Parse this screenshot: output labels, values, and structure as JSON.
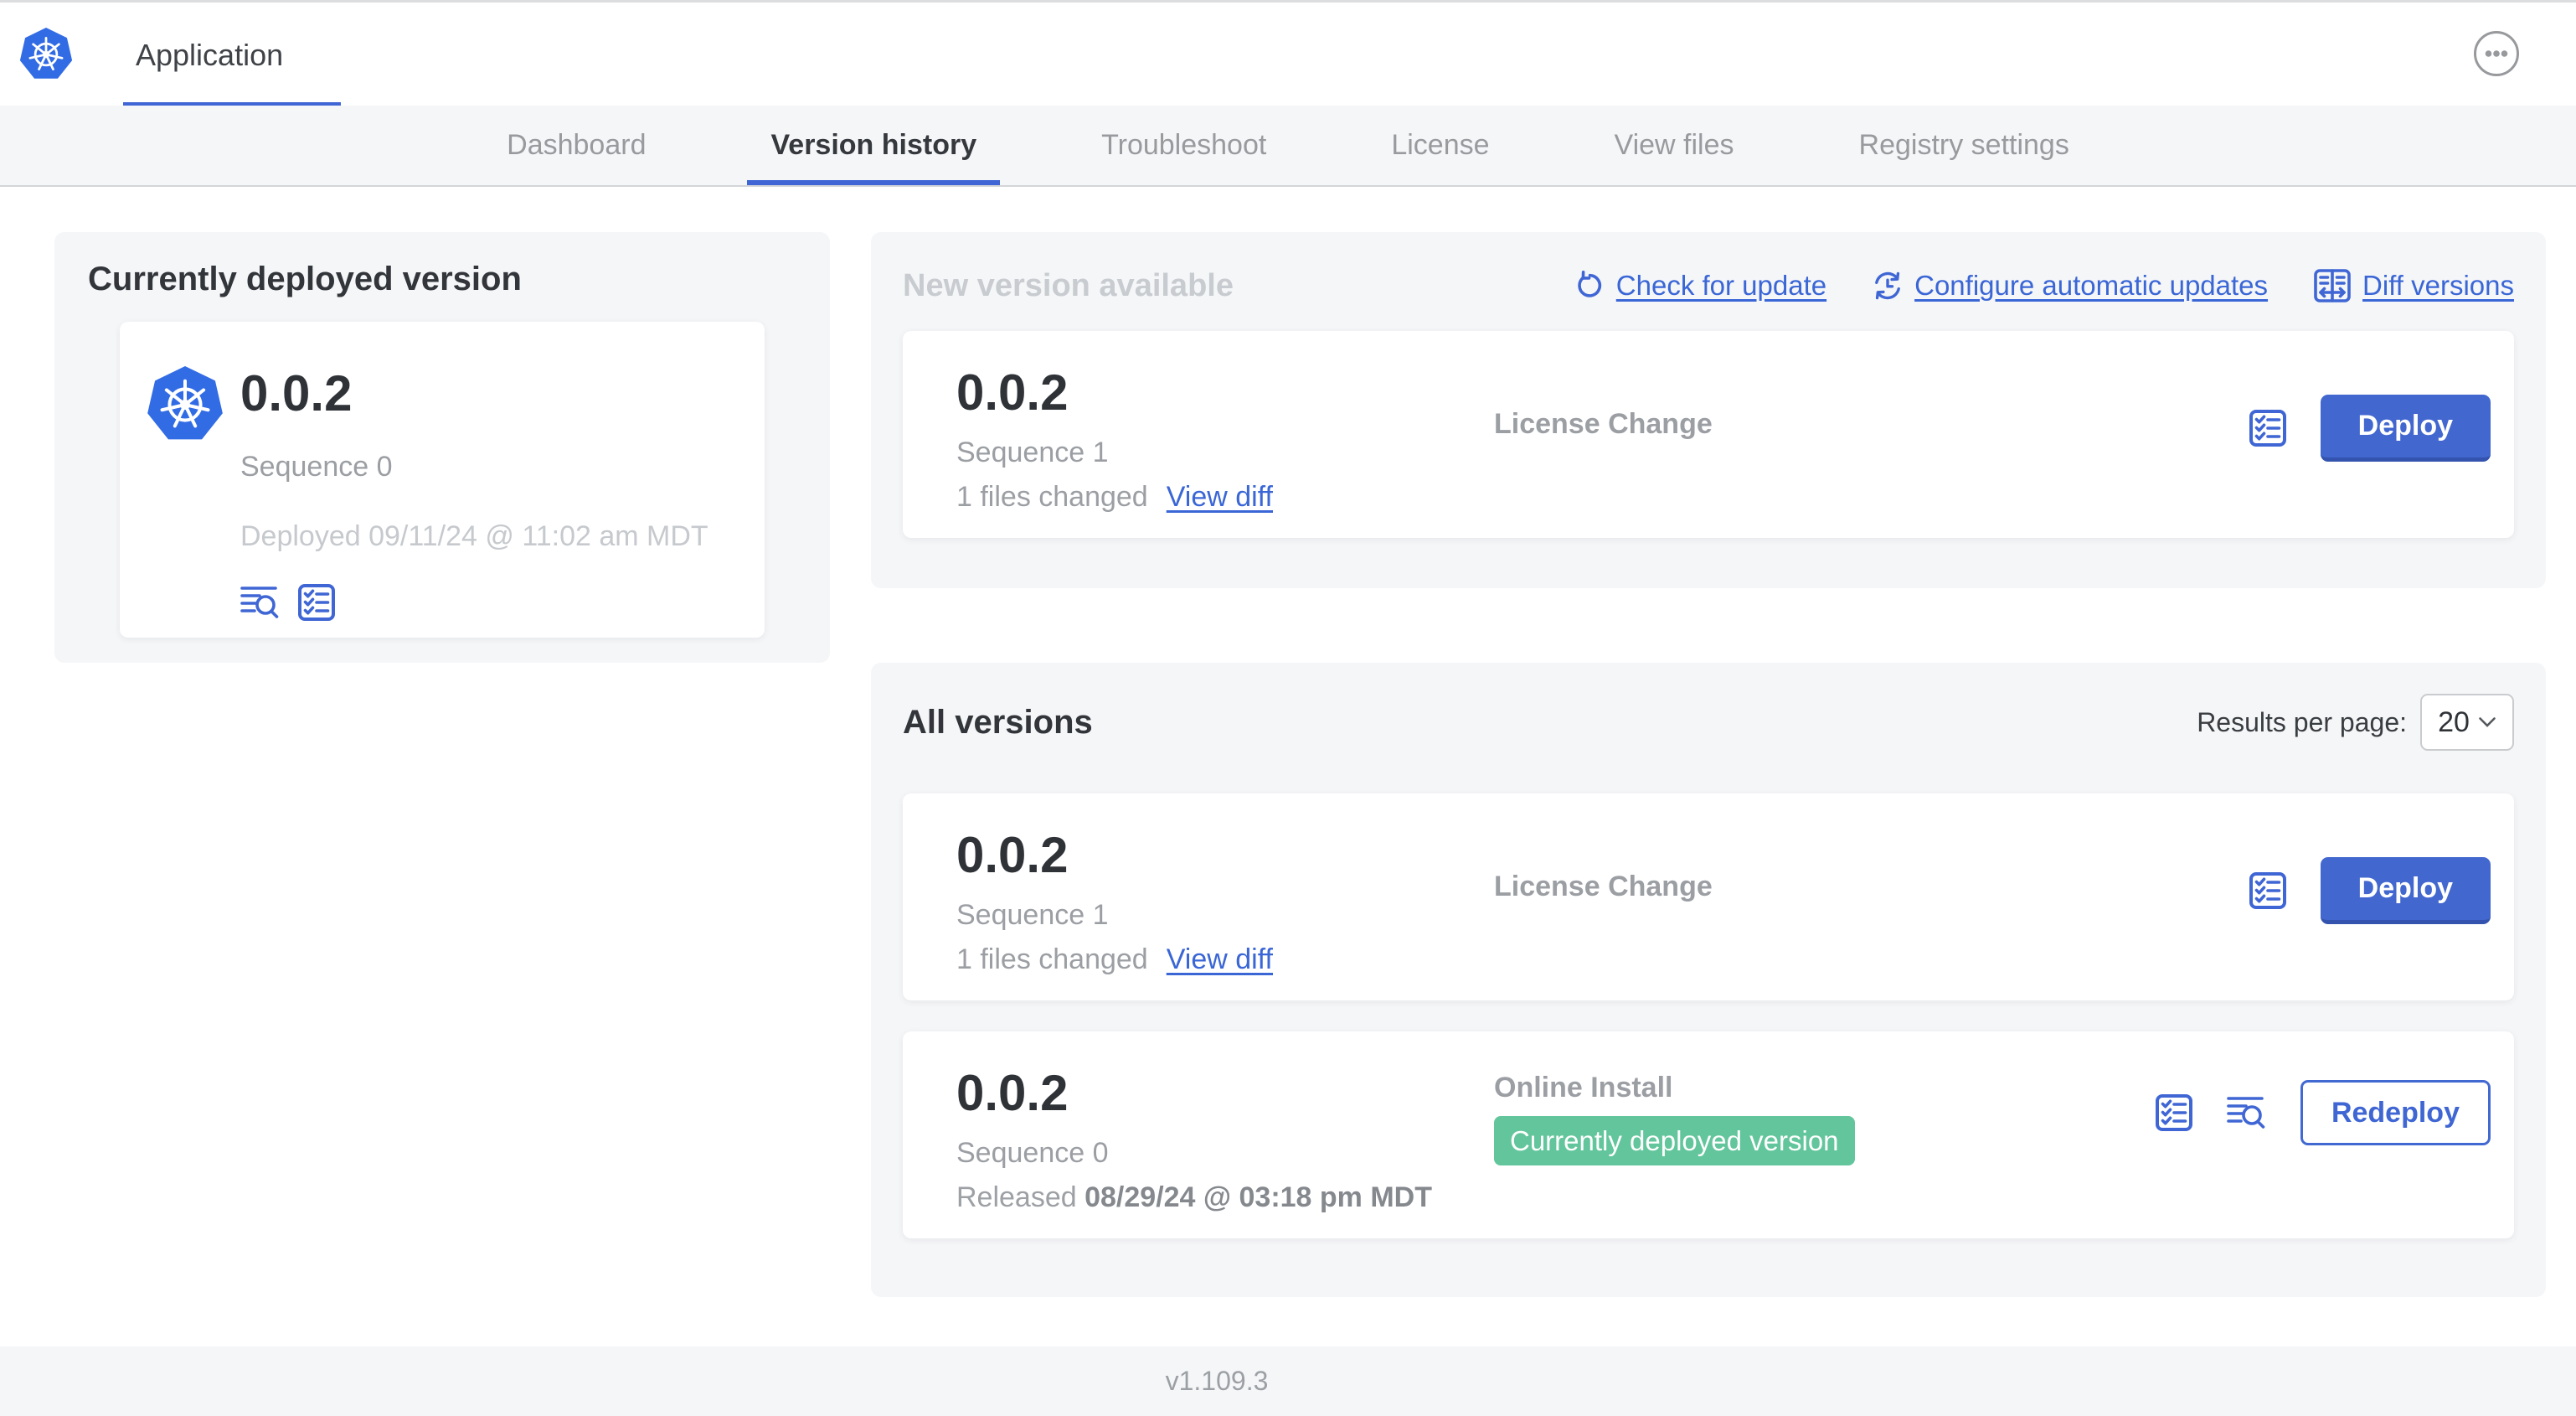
{
  "header": {
    "app_tab_label": "Application"
  },
  "nav": {
    "tabs": [
      {
        "label": "Dashboard",
        "active": false
      },
      {
        "label": "Version history",
        "active": true
      },
      {
        "label": "Troubleshoot",
        "active": false
      },
      {
        "label": "License",
        "active": false
      },
      {
        "label": "View files",
        "active": false
      },
      {
        "label": "Registry settings",
        "active": false
      }
    ]
  },
  "current_version_card": {
    "title": "Currently deployed version",
    "version": "0.0.2",
    "sequence": "Sequence 0",
    "deployed": "Deployed 09/11/24 @ 11:02 am MDT"
  },
  "new_version_section": {
    "heading": "New version available",
    "actions": {
      "check_for_update": "Check for update",
      "configure_automatic_updates": "Configure automatic updates",
      "diff_versions": "Diff versions"
    },
    "row": {
      "version": "0.0.2",
      "sequence": "Sequence 1",
      "files_changed": "1 files changed",
      "view_diff": "View diff",
      "source": "License Change",
      "deploy": "Deploy"
    }
  },
  "all_versions_section": {
    "title": "All versions",
    "results_per_page_label": "Results per page:",
    "results_per_page_value": "20",
    "rows": [
      {
        "version": "0.0.2",
        "sequence": "Sequence 1",
        "files_changed": "1 files changed",
        "view_diff": "View diff",
        "source": "License Change",
        "action": "Deploy"
      },
      {
        "version": "0.0.2",
        "sequence": "Sequence 0",
        "released_prefix": "Released ",
        "released_date": "08/29/24 @ 03:18 pm MDT",
        "source": "Online Install",
        "badge": "Currently deployed version",
        "action": "Redeploy"
      }
    ]
  },
  "footer": {
    "app_version": "v1.109.3"
  },
  "colors": {
    "accent_blue": "#3f66d4",
    "kubernetes_logo_blue": "#326ce5",
    "button_blue": "#4267cf",
    "button_blue_edge": "#3353ae",
    "badge_green": "#63c59b",
    "card_background": "#f5f6f8",
    "muted_text": "#9b9ea3",
    "faint_text": "#c6c9cd",
    "dark_text": "#32353a"
  },
  "icons": {
    "kubernetes-logo-icon": "blue heptagon with white ship wheel",
    "overflow-menu-icon": "circled horizontal ellipsis",
    "check-for-update-icon": "counterclockwise refresh arrow",
    "configure-automatic-updates-icon": "circular sync arrows with clock hands",
    "diff-versions-icon": "split panel with left-right arrows",
    "deploy-logs-icon": "text lines with magnifying glass",
    "preflight-checks-icon": "checklist in rounded square",
    "chevron-down-icon": "dropdown chevron"
  }
}
